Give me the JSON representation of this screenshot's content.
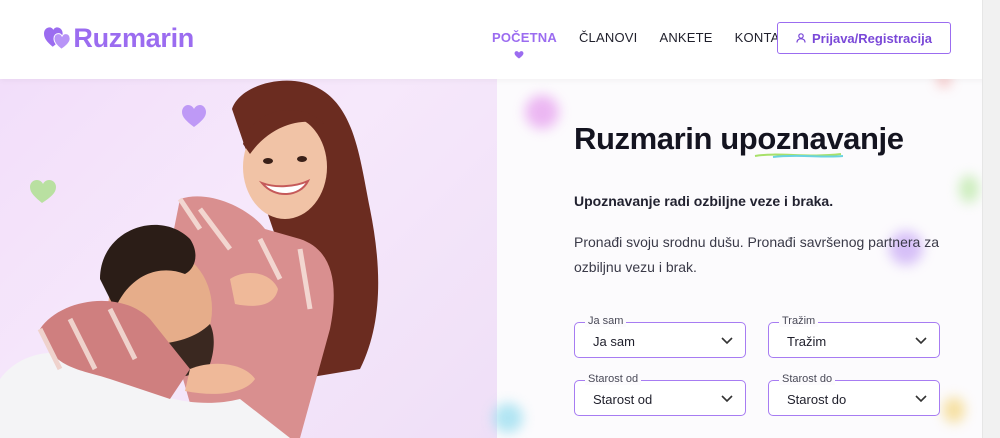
{
  "brand": {
    "name": "Ruzmarin",
    "color": "#9b6cf0"
  },
  "nav": {
    "items": [
      {
        "label": "POČETNA",
        "active": true
      },
      {
        "label": "ČLANOVI",
        "active": false
      },
      {
        "label": "ANKETE",
        "active": false
      },
      {
        "label": "KONTAKT",
        "active": false
      }
    ],
    "login_label": "Prijava/Registracija",
    "login_icon": "user-icon"
  },
  "hero": {
    "title": "Ruzmarin upoznavanje",
    "subtitle": "Upoznavanje radi ozbiljne veze i braka.",
    "description": "Pronađi svoju srodnu dušu. Pronađi savršenog partnera za ozbiljnu vezu i brak."
  },
  "search": {
    "fields": [
      {
        "label": "Ja sam",
        "value": "Ja sam"
      },
      {
        "label": "Tražim",
        "value": "Tražim"
      },
      {
        "label": "Starost od",
        "value": "Starost od"
      },
      {
        "label": "Starost do",
        "value": "Starost do"
      }
    ]
  },
  "colors": {
    "accent": "#9b6cf0",
    "hero_bg": "#f2defa"
  }
}
